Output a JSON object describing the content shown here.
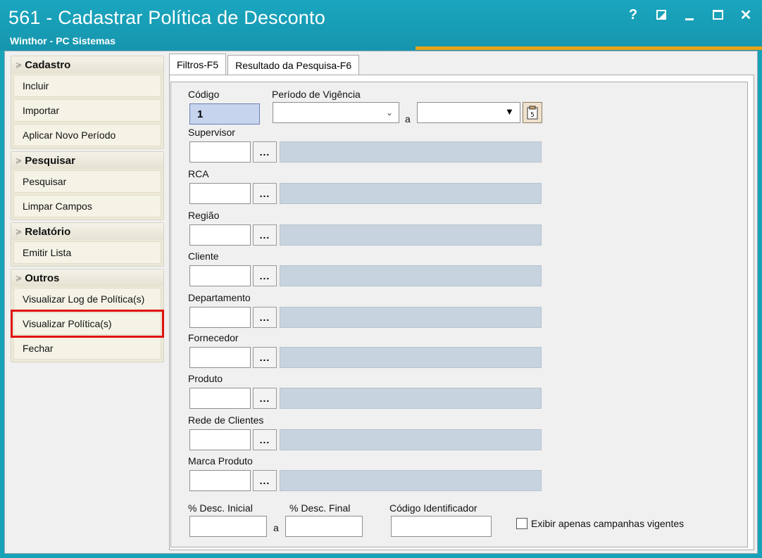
{
  "window": {
    "title": "561 - Cadastrar Política de Desconto",
    "subtitle": "Winthor - PC Sistemas",
    "help_label": "?",
    "close_label": "✕"
  },
  "sidebar": {
    "groups": [
      {
        "title": "Cadastro",
        "items": [
          "Incluir",
          "Importar",
          "Aplicar Novo Período"
        ]
      },
      {
        "title": "Pesquisar",
        "items": [
          "Pesquisar",
          "Limpar Campos"
        ]
      },
      {
        "title": "Relatório",
        "items": [
          "Emitir Lista"
        ]
      },
      {
        "title": "Outros",
        "items": [
          "Visualizar Log de Política(s)",
          "Visualizar Política(s)",
          "Fechar"
        ]
      }
    ]
  },
  "tabs": [
    "Filtros-F5",
    "Resultado da Pesquisa-F6"
  ],
  "form": {
    "codigo_label": "Código",
    "codigo_value": "1",
    "periodo_label": "Período de Vigência",
    "periodo_sep": "a",
    "lookups": [
      "Supervisor",
      "RCA",
      "Região",
      "Cliente",
      "Departamento",
      "Fornecedor",
      "Produto",
      "Rede de Clientes",
      "Marca Produto"
    ],
    "dots_label": "...",
    "desc_inicial_label": "% Desc. Inicial",
    "desc_sep": "a",
    "desc_final_label": "% Desc. Final",
    "codigo_identificador_label": "Código Identificador",
    "exibir_label": "Exibir apenas campanhas vigentes"
  },
  "colors": {
    "titlebar": "#1aa6bf",
    "accent": "#e8a317",
    "highlight": "#e01010"
  }
}
